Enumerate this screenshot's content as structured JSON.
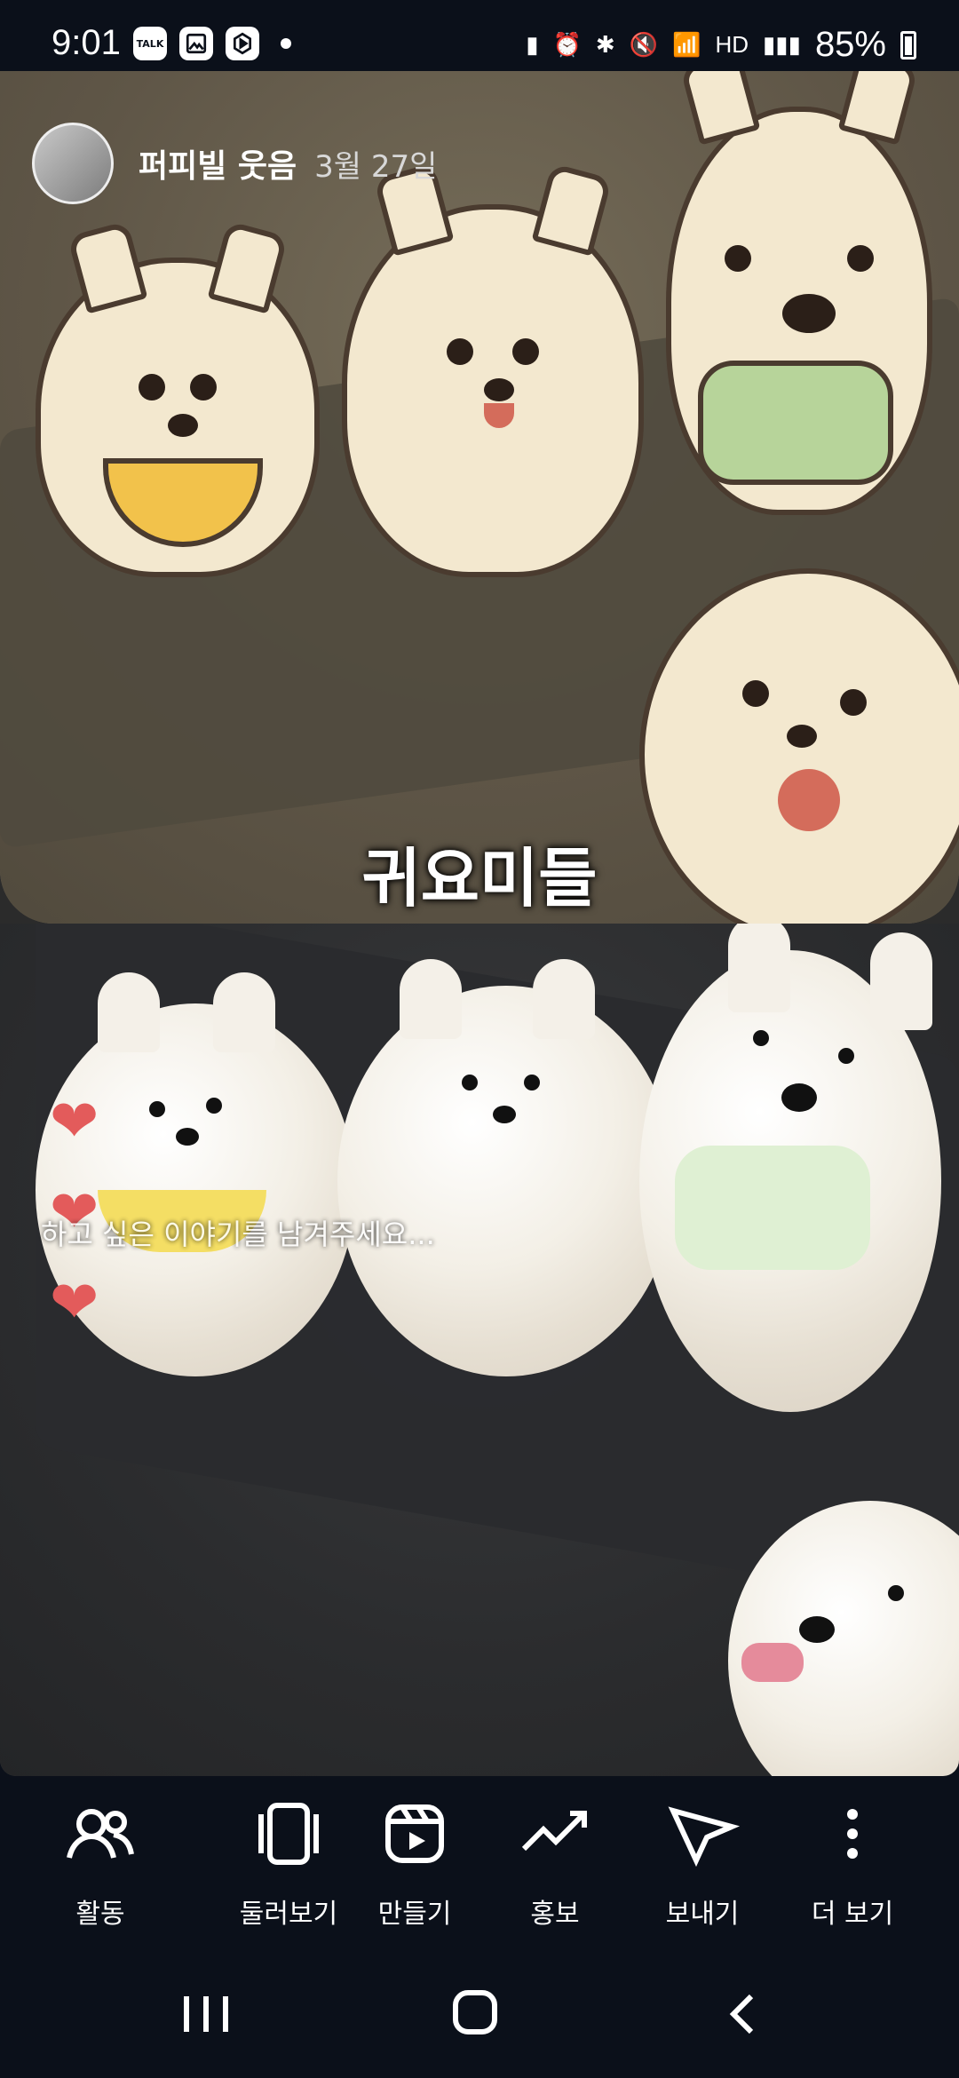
{
  "status_bar": {
    "time": "9:01",
    "left_icons": [
      "talk-notification-icon",
      "gallery-notification-icon",
      "app-notification-icon",
      "more-dot-icon"
    ],
    "talk_badge": "TALK",
    "right_icons": [
      "charging-icon",
      "alarm-icon",
      "bluetooth-icon",
      "mute-icon",
      "wifi-icon",
      "hd-voice-icon",
      "signal-icon",
      "battery-icon"
    ],
    "hd_label": "HD",
    "battery": "85%"
  },
  "story": {
    "username": "퍼피빌 웃음",
    "date": "3월 27일",
    "caption": "귀요미들",
    "comment_placeholder": "하고 싶은 이야기를 남겨주세요...",
    "hearts": 3,
    "heart_color": "#e35b5b"
  },
  "actions": [
    {
      "label": "활동",
      "icon": "people-icon"
    },
    {
      "label": "둘러보기",
      "icon": "cards-icon"
    },
    {
      "label": "만들기",
      "icon": "reel-icon"
    },
    {
      "label": "홍보",
      "icon": "trend-icon"
    },
    {
      "label": "보내기",
      "icon": "send-icon"
    },
    {
      "label": "더 보기",
      "icon": "more-vertical-icon"
    }
  ],
  "nav": {
    "recents_icon": "recents-icon",
    "home_icon": "home-icon",
    "back_icon": "back-icon"
  }
}
